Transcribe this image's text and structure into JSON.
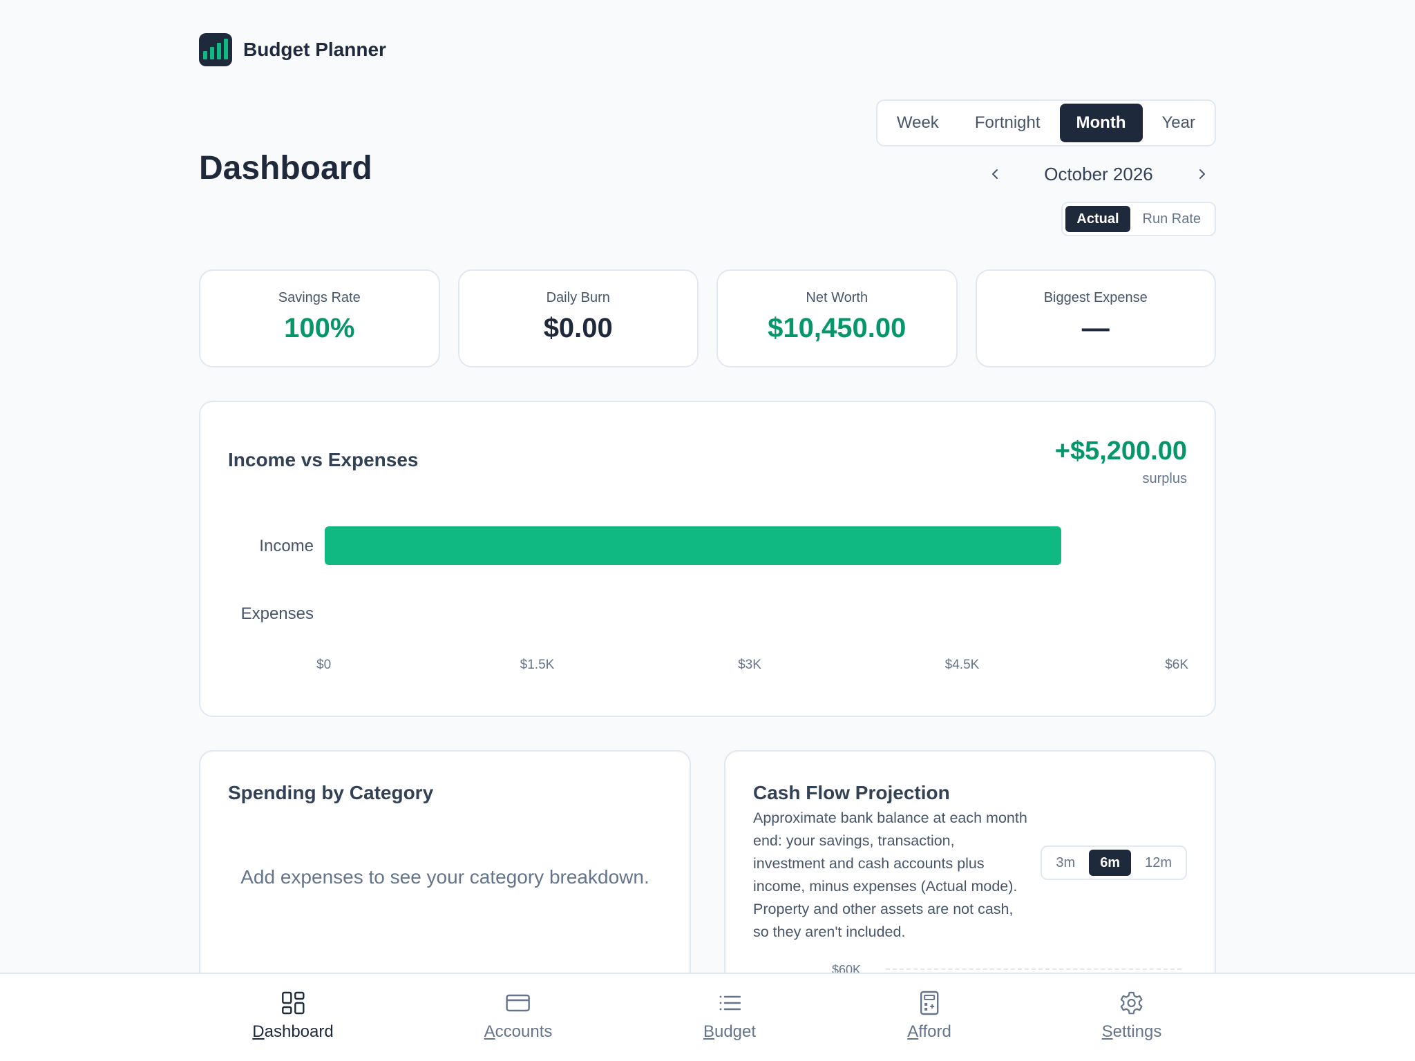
{
  "app": {
    "name": "Budget Planner"
  },
  "page": {
    "title": "Dashboard"
  },
  "period_toggle": {
    "options": [
      "Week",
      "Fortnight",
      "Month",
      "Year"
    ],
    "selected": "Month"
  },
  "month_nav": {
    "label": "October 2026"
  },
  "mode_toggle": {
    "options": [
      "Actual",
      "Run Rate"
    ],
    "selected": "Actual"
  },
  "stats": [
    {
      "label": "Savings Rate",
      "value": "100%"
    },
    {
      "label": "Daily Burn",
      "value": "$0.00"
    },
    {
      "label": "Net Worth",
      "value": "$10,450.00"
    },
    {
      "label": "Biggest Expense",
      "value": "—"
    }
  ],
  "income_vs_expenses": {
    "title": "Income vs Expenses",
    "surplus_value": "+$5,200.00",
    "surplus_label": "surplus"
  },
  "chart_data": {
    "type": "bar",
    "orientation": "horizontal",
    "categories": [
      "Income",
      "Expenses"
    ],
    "values": [
      5200,
      0
    ],
    "xlim": [
      0,
      6000
    ],
    "xticks": [
      "$0",
      "$1.5K",
      "$3K",
      "$4.5K",
      "$6K"
    ],
    "grid": false,
    "colors": {
      "income": "#10b981",
      "expenses": "#ef4444"
    }
  },
  "spending": {
    "title": "Spending by Category",
    "empty_message": "Add expenses to see your category breakdown."
  },
  "cash_flow": {
    "title": "Cash Flow Projection",
    "description": "Approximate bank balance at each month end: your savings, transaction, investment and cash accounts plus income, minus expenses (Actual mode). Property and other assets are not cash, so they aren't included.",
    "range_options": [
      "3m",
      "6m",
      "12m"
    ],
    "range_selected": "6m",
    "y_tick_top": "$60K"
  },
  "bottom_nav": [
    {
      "label": "Dashboard",
      "icon": "dashboard-grid-icon"
    },
    {
      "label": "Accounts",
      "icon": "credit-card-icon"
    },
    {
      "label": "Budget",
      "icon": "list-icon"
    },
    {
      "label": "Afford",
      "icon": "calculator-icon"
    },
    {
      "label": "Settings",
      "icon": "gear-icon"
    }
  ],
  "colors": {
    "accent": "#10b981",
    "primary_dark": "#1e293b",
    "positive_text": "#059669"
  }
}
